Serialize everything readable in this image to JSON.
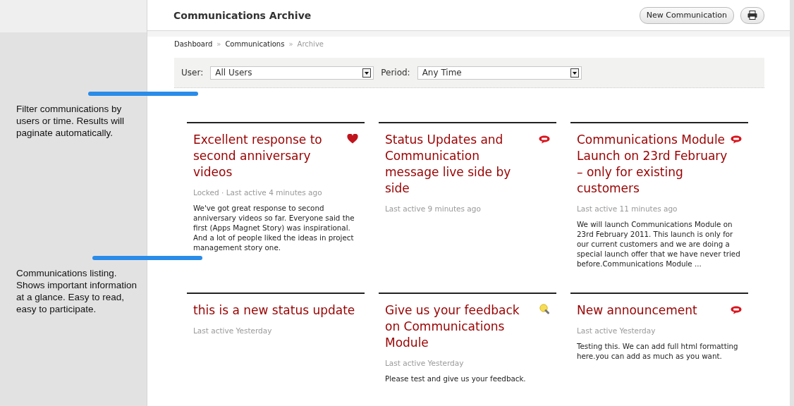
{
  "header": {
    "title": "Communications Archive",
    "new_button": "New Communication"
  },
  "breadcrumb": [
    {
      "label": "Dashboard",
      "current": false
    },
    {
      "label": "Communications",
      "current": false
    },
    {
      "label": "Archive",
      "current": true
    }
  ],
  "breadcrumb_separator": "»",
  "filters": [
    {
      "label": "User:",
      "value": "All Users"
    },
    {
      "label": "Period:",
      "value": "Any Time"
    }
  ],
  "annotations": [
    {
      "text": "Filter communications by users or time. Results will paginate automatically."
    },
    {
      "text": "Communications listing. Shows important information at a glance. Easy to read, easy to participate."
    }
  ],
  "cards": [
    {
      "title": "Excellent response to second anniversary videos",
      "kind": "heart",
      "meta": "Locked · Last active 4 minutes ago",
      "body": "We've got great response to second anniversary videos so far. Everyone said the first (Apps Magnet Story) was inspirational. And a lot of people liked the ideas in project management story one."
    },
    {
      "title": "Status Updates and Communication message live side by side",
      "kind": "speech",
      "meta": "Last active 9 minutes ago"
    },
    {
      "title": "Communications Module Launch on 23rd February – only for existing customers",
      "kind": "speech",
      "meta": "Last active 11 minutes ago",
      "body": "We will launch Communications Module on 23rd February 2011. This launch is only for our current customers and we are doing a special launch offer that we have never tried before.Communications Module ..."
    },
    {
      "title": "this is a new status update",
      "kind": "none",
      "meta": "Last active Yesterday"
    },
    {
      "title": "Give us your feedback on Communications Module",
      "kind": "bulb",
      "meta": "Last active Yesterday",
      "body": "Please test and give us your feedback."
    },
    {
      "title": "New announcement",
      "kind": "speech",
      "meta": "Last active Yesterday",
      "body": "Testing this. We can add full html formatting here.you can add as much as you want."
    }
  ]
}
